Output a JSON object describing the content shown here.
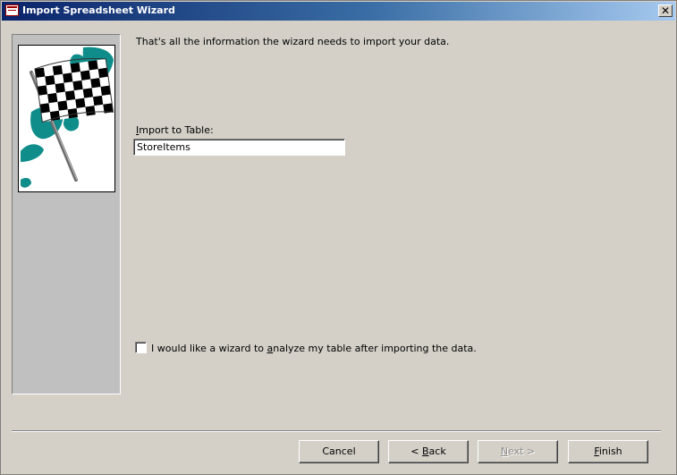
{
  "window": {
    "title": "Import Spreadsheet Wizard",
    "close_glyph": "✕"
  },
  "icons": {
    "app": "access-form-icon",
    "close": "close-icon",
    "side_image": "checkered-flag-icon"
  },
  "content": {
    "intro_text": "That's all the information the wizard needs to import your data.",
    "table_label_mnemonic": "I",
    "table_label_rest": "mport to Table:",
    "table_name": "StoreItems",
    "analyze_checked": false,
    "analyze_label_before": "I would like a wizard to ",
    "analyze_label_mnemonic": "a",
    "analyze_label_after": "nalyze my table after importing the data."
  },
  "buttons": {
    "cancel": "Cancel",
    "back_prefix": "< ",
    "back_mnemonic": "B",
    "back_rest": "ack",
    "next_prefix": "",
    "next_mnemonic": "N",
    "next_rest": "ext >",
    "finish_mnemonic": "F",
    "finish_rest": "inish"
  },
  "colors": {
    "dialog_bg": "#d4d0c8",
    "title_gradient_start": "#0a246a",
    "title_gradient_end": "#a6caf0",
    "side_panel": "#c0c0c0",
    "flag_teal": "#0f8d8a"
  }
}
